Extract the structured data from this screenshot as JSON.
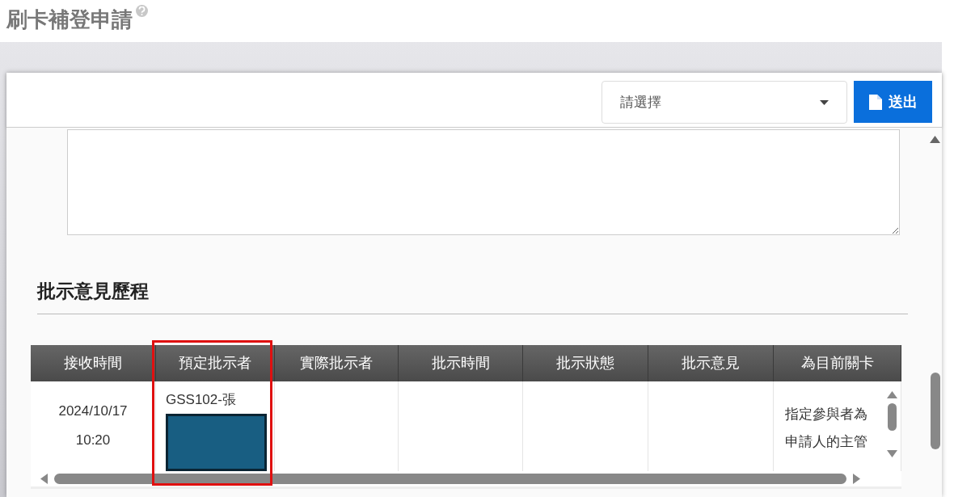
{
  "page_title": "刷卡補登申請",
  "toolbar": {
    "select": {
      "placeholder": "請選擇"
    },
    "submit_button": "送出"
  },
  "history": {
    "heading": "批示意見歷程",
    "columns": [
      {
        "label": "接收時間",
        "highlighted": false
      },
      {
        "label": "預定批示者",
        "highlighted": true
      },
      {
        "label": "實際批示者",
        "highlighted": false
      },
      {
        "label": "批示時間",
        "highlighted": false
      },
      {
        "label": "批示狀態",
        "highlighted": false
      },
      {
        "label": "批示意見",
        "highlighted": false
      },
      {
        "label": "為目前關卡",
        "highlighted": false
      }
    ],
    "rows": [
      {
        "cells": [
          {
            "kind": "text",
            "lines": [
              "2024/10/17",
              "10:20"
            ]
          },
          {
            "kind": "redacted",
            "lines": [
              "GSS102-張"
            ]
          },
          {
            "kind": "empty"
          },
          {
            "kind": "empty"
          },
          {
            "kind": "empty"
          },
          {
            "kind": "empty"
          },
          {
            "kind": "scroll",
            "lines": [
              "指定參與者為",
              "申請人的主管"
            ]
          }
        ]
      }
    ]
  }
}
